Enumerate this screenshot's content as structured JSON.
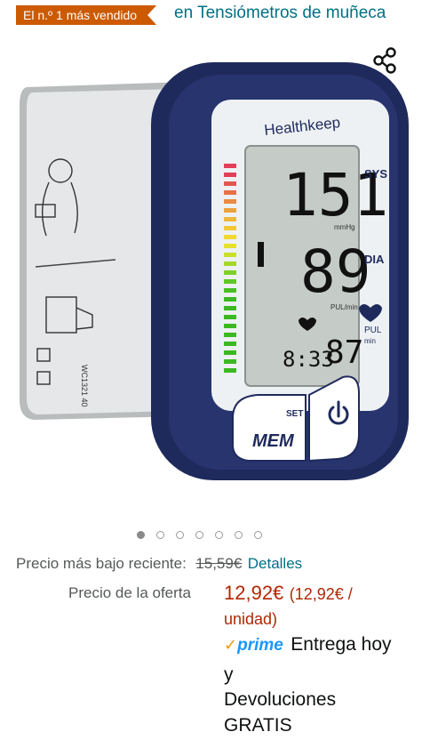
{
  "header": {
    "badge_label": "El n.º 1 más vendido",
    "category_link": "en Tensiómetros de muñeca"
  },
  "product": {
    "brand_on_device": "Healthkeep",
    "display": {
      "sys_value": "151",
      "sys_label": "SYS",
      "sys_unit": "mmHg",
      "dia_value": "89",
      "dia_label": "DIA",
      "pul_unit": "PUL/min",
      "time": "8:33",
      "pulse": "87",
      "pul_label": "PUL",
      "pul_sub": "min"
    },
    "buttons": {
      "mem": "MEM",
      "set": "SET"
    }
  },
  "carousel": {
    "total": 7,
    "active_index": 0
  },
  "pricing": {
    "recent_low_label": "Precio más bajo reciente:",
    "recent_low_price": "15,59€",
    "details_link": "Detalles",
    "offer_label": "Precio de la oferta",
    "offer_price": "12,92€",
    "unit_price_line1": "(12,92€ /",
    "unit_price_line2": "unidad)"
  },
  "delivery": {
    "prime_check": "✓",
    "prime_label": "prime",
    "delivery_text": "Entrega hoy",
    "and": "y",
    "returns_line1": "Devoluciones",
    "returns_line2": "GRATIS"
  },
  "colors": {
    "badge": "#cc5a00",
    "link": "#007185",
    "price": "#b12704",
    "device_navy": "#1f2a5c"
  }
}
